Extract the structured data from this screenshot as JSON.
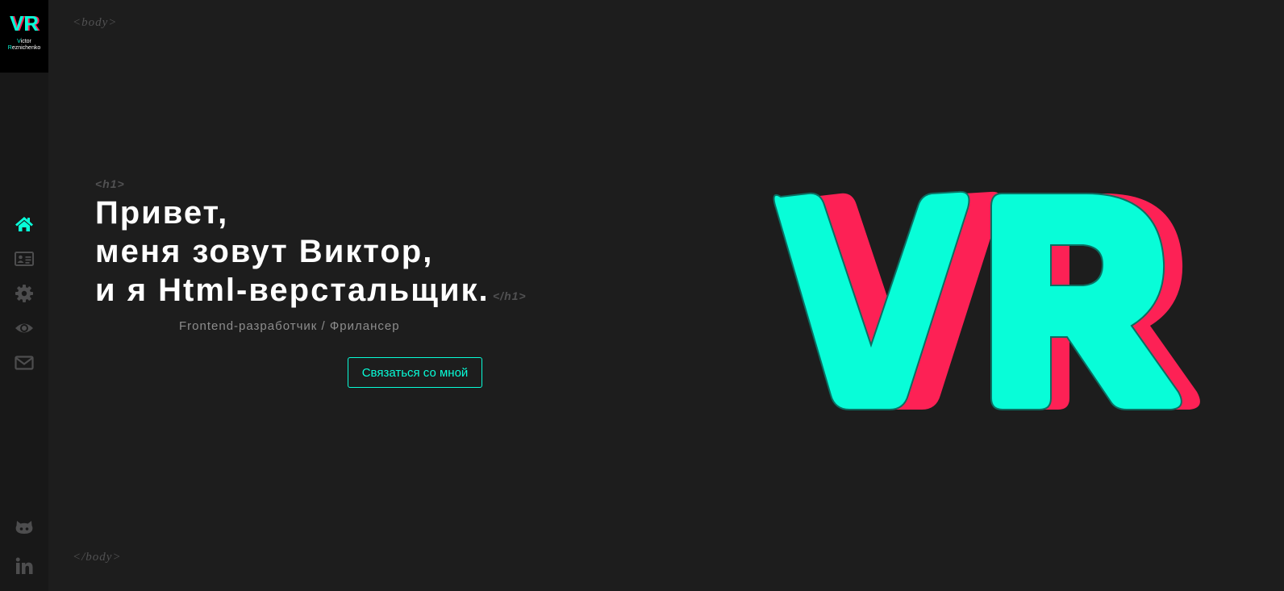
{
  "brand": {
    "initials": "VR",
    "first_name": "Victor",
    "last_name": "Reznichenko"
  },
  "sidebar": {
    "items": [
      {
        "icon": "home-icon",
        "label": "Home"
      },
      {
        "icon": "id-card-icon",
        "label": "About"
      },
      {
        "icon": "gear-icon",
        "label": "Skills"
      },
      {
        "icon": "eye-icon",
        "label": "Portfolio"
      },
      {
        "icon": "envelope-icon",
        "label": "Contact"
      }
    ],
    "social": [
      {
        "icon": "github-icon"
      },
      {
        "icon": "linkedin-icon"
      }
    ]
  },
  "tags": {
    "body_open": "<body>",
    "body_close": "</body>",
    "h1_open": "<h1>",
    "h1_close": "</h1>"
  },
  "hero": {
    "line1": "Привет,",
    "line2": "меня зовут Виктор,",
    "line3": "и я Html-верстальщик.",
    "subtitle": "Frontend-разработчик / Фрилансер",
    "cta": "Связаться со мной"
  },
  "colors": {
    "accent": "#08fdd8",
    "accent_shadow": "#fd2155",
    "background": "#1d1d1d",
    "sidebar": "#181818"
  }
}
